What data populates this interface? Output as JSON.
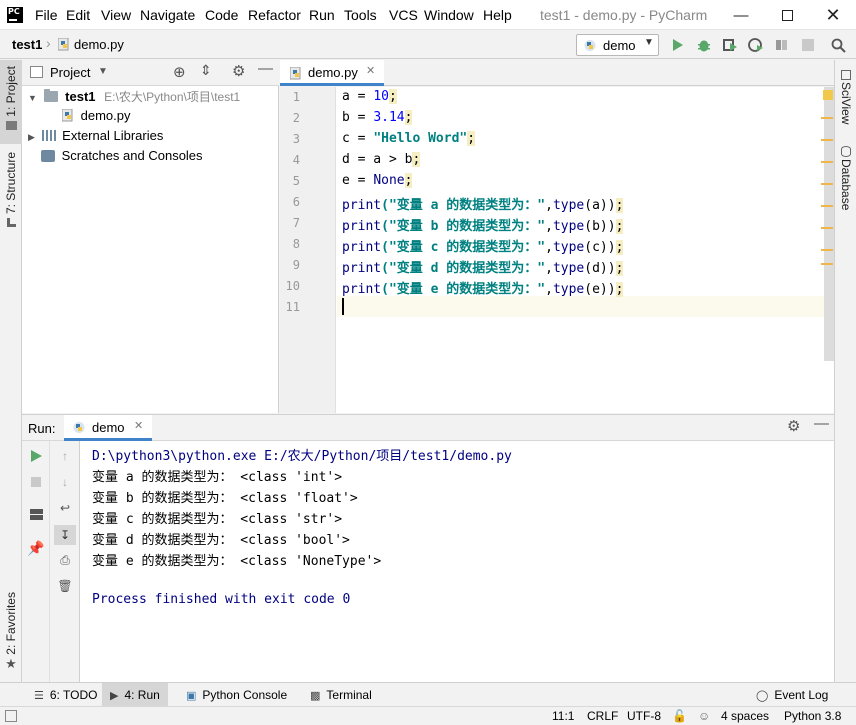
{
  "app": {
    "logo_text": "PC",
    "window_title": "test1 - demo.py - PyCharm"
  },
  "menu": [
    "File",
    "Edit",
    "View",
    "Navigate",
    "Code",
    "Refactor",
    "Run",
    "Tools",
    "VCS",
    "Window",
    "Help"
  ],
  "nav": {
    "project": "test1",
    "file": "demo.py",
    "run_config": "demo"
  },
  "left_tabs": {
    "project": "1: Project",
    "structure": "7: Structure",
    "favorites": "2: Favorites"
  },
  "right_tabs": {
    "sciview": "SciView",
    "database": "Database"
  },
  "project_panel": {
    "title": "Project",
    "tree": [
      {
        "name": "test1",
        "path": "E:\\农大\\Python\\项目\\test1"
      },
      {
        "name": "demo.py"
      },
      {
        "name": "External Libraries"
      },
      {
        "name": "Scratches and Consoles"
      }
    ]
  },
  "editor": {
    "tab": "demo.py",
    "line_numbers": [
      "1",
      "2",
      "3",
      "4",
      "5",
      "6",
      "7",
      "8",
      "9",
      "10",
      "11"
    ],
    "lines": [
      {
        "a": "a = ",
        "b": "10",
        "c": ";"
      },
      {
        "a": "b = ",
        "b": "3.14",
        "c": ";"
      },
      {
        "a": "c = ",
        "b": "\"Hello Word\"",
        "c": ";"
      },
      {
        "a": "d = a > b",
        "c": ";"
      },
      {
        "a": "e = ",
        "b": "None",
        "c": ";"
      },
      {
        "a": "print",
        "s": "(\"变量 a 的数据类型为：\"",
        "t": ",",
        "u": "type",
        "v": "(a))",
        "c": ";"
      },
      {
        "a": "print",
        "s": "(\"变量 b 的数据类型为：\"",
        "t": ",",
        "u": "type",
        "v": "(b))",
        "c": ";"
      },
      {
        "a": "print",
        "s": "(\"变量 c 的数据类型为：\"",
        "t": ",",
        "u": "type",
        "v": "(c))",
        "c": ";"
      },
      {
        "a": "print",
        "s": "(\"变量 d 的数据类型为：\"",
        "t": ",",
        "u": "type",
        "v": "(d))",
        "c": ";"
      },
      {
        "a": "print",
        "s": "(\"变量 e 的数据类型为：\"",
        "t": ",",
        "u": "type",
        "v": "(e))",
        "c": ";"
      },
      {
        "a": ""
      }
    ]
  },
  "run_panel": {
    "label": "Run:",
    "tab": "demo",
    "output": [
      "D:\\python3\\python.exe E:/农大/Python/项目/test1/demo.py",
      "变量 a 的数据类型为： <class 'int'>",
      "变量 b 的数据类型为： <class 'float'>",
      "变量 c 的数据类型为： <class 'str'>",
      "变量 d 的数据类型为： <class 'bool'>",
      "变量 e 的数据类型为： <class 'NoneType'>",
      "",
      "Process finished with exit code 0"
    ]
  },
  "bottom_tabs": {
    "todo": "6: TODO",
    "run": "4: Run",
    "python_console": "Python Console",
    "terminal": "Terminal",
    "event_log": "Event Log"
  },
  "status": {
    "position": "11:1",
    "line_sep": "CRLF",
    "encoding": "UTF-8",
    "indent": "4 spaces",
    "interpreter": "Python 3.8"
  },
  "colors": {
    "accent": "#4083c9",
    "run_green": "#59a869",
    "keyword": "#000080",
    "string": "#008080",
    "number": "#0000ff"
  }
}
